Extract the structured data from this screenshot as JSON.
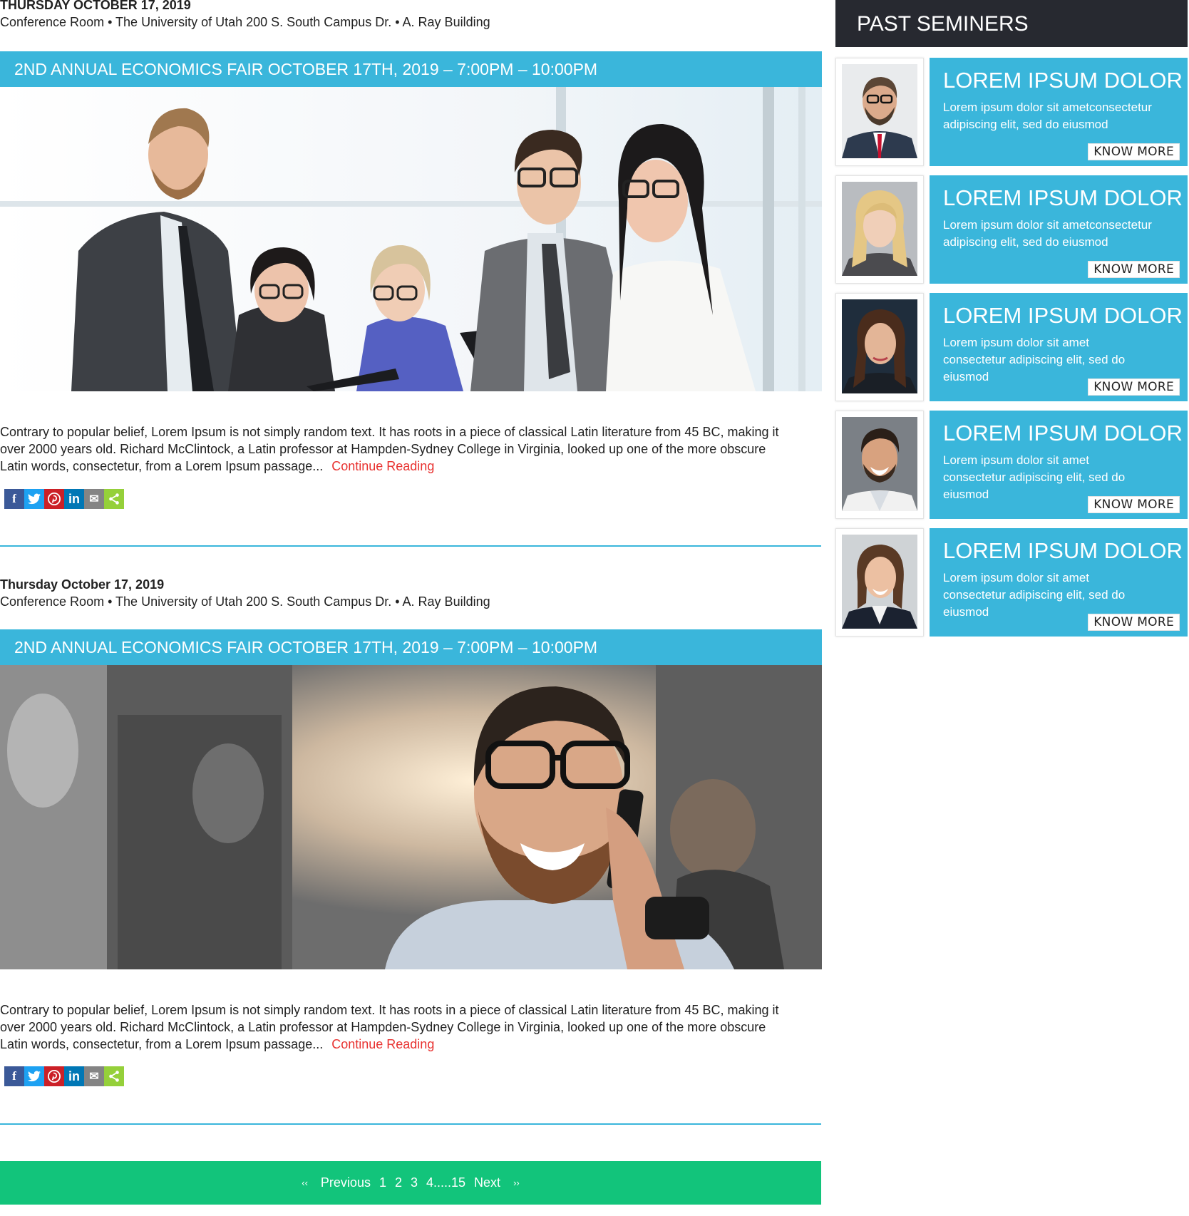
{
  "posts": [
    {
      "date": "THURSDAY OCTOBER 17, 2019",
      "location": "Conference Room • The University of Utah 200 S. South Campus Dr. • A. Ray Building",
      "title": "2ND ANNUAL ECONOMICS FAIR OCTOBER 17TH, 2019 – 7:00PM – 10:00PM",
      "excerpt": "Contrary to popular belief, Lorem Ipsum is not simply random text. It has roots in a piece of classical Latin literature from 45 BC, making it over 2000 years old. Richard McClintock, a Latin professor at Hampden-Sydney College in Virginia, looked up one of the more obscure Latin words, consectetur, from a Lorem Ipsum passage...",
      "continue_label": "Continue Reading"
    },
    {
      "date": "Thursday October 17, 2019",
      "location": "Conference Room • The University of Utah 200 S. South Campus Dr. • A. Ray Building",
      "title": "2ND ANNUAL ECONOMICS FAIR OCTOBER 17TH, 2019 – 7:00PM – 10:00PM",
      "excerpt": "Contrary to popular belief, Lorem Ipsum is not simply random text. It has roots in a piece of classical Latin literature from 45 BC, making it over 2000 years old. Richard McClintock, a Latin professor at Hampden-Sydney College in Virginia, looked up one of the more obscure Latin words, consectetur, from a Lorem Ipsum passage...",
      "continue_label": "Continue Reading"
    }
  ],
  "share": {
    "facebook": "f",
    "twitter": "t",
    "pinterest": "p",
    "linkedin": "in",
    "email": "✉",
    "more": "<",
    "colors": {
      "facebook": "#3b5998",
      "twitter": "#1da1f2",
      "pinterest": "#cb2027",
      "linkedin": "#0077b5",
      "email": "#848484",
      "more": "#95d03a"
    }
  },
  "pager": {
    "prev_arrow": "‹‹",
    "previous": "Previous",
    "pages": [
      "1",
      "2",
      "3",
      "4.....15"
    ],
    "next": "Next",
    "next_arrow": "››"
  },
  "sidebar": {
    "title": "PAST SEMINERS",
    "cards": [
      {
        "title": "LOREM IPSUM DOLOR",
        "text": "Lorem ipsum dolor sit ametconsectetur adipiscing elit, sed do eiusmod",
        "button": "KNOW MORE"
      },
      {
        "title": "LOREM IPSUM DOLOR",
        "text": "Lorem ipsum dolor sit ametconsectetur adipiscing elit, sed do eiusmod",
        "button": "KNOW MORE"
      },
      {
        "title": "LOREM IPSUM DOLOR",
        "text": "Lorem ipsum dolor sit amet consectetur adipiscing elit, sed do eiusmod",
        "button": "KNOW MORE"
      },
      {
        "title": "LOREM IPSUM DOLOR",
        "text": "Lorem ipsum dolor sit amet consectetur adipiscing elit, sed do eiusmod",
        "button": "KNOW MORE"
      },
      {
        "title": "LOREM IPSUM DOLOR",
        "text": "Lorem ipsum dolor sit amet consectetur adipiscing elit, sed do eiusmod",
        "button": "KNOW MORE"
      }
    ]
  },
  "colors": {
    "accent": "#3ab6db",
    "pager": "#12c47b",
    "dark": "#272930",
    "link": "#e8312f"
  }
}
